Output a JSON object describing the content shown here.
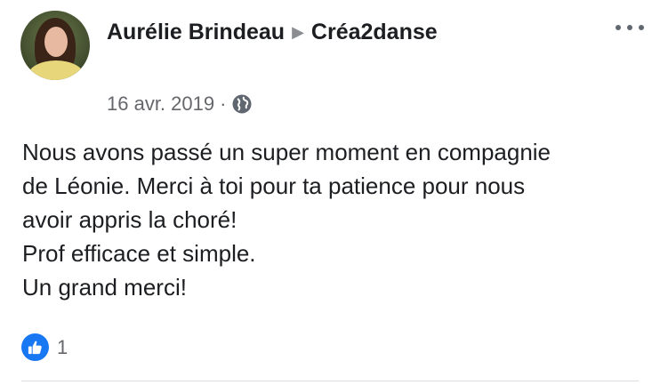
{
  "post": {
    "author": "Aurélie Brindeau",
    "page": "Créa2danse",
    "date": "16 avr. 2019",
    "separator": "·",
    "privacy_icon": "globe-icon",
    "more_icon": "more-options-icon",
    "text_lines": [
      "Nous avons passé un super moment en compagnie",
      "de Léonie. Merci à toi pour ta patience pour nous",
      "avoir appris la choré!",
      "Prof efficace et simple.",
      "Un grand merci!"
    ],
    "reaction_icon": "like-icon",
    "reaction_count": "1"
  },
  "colors": {
    "accent": "#1877f2",
    "text": "#1c1e21",
    "secondary_text": "#65676b"
  }
}
